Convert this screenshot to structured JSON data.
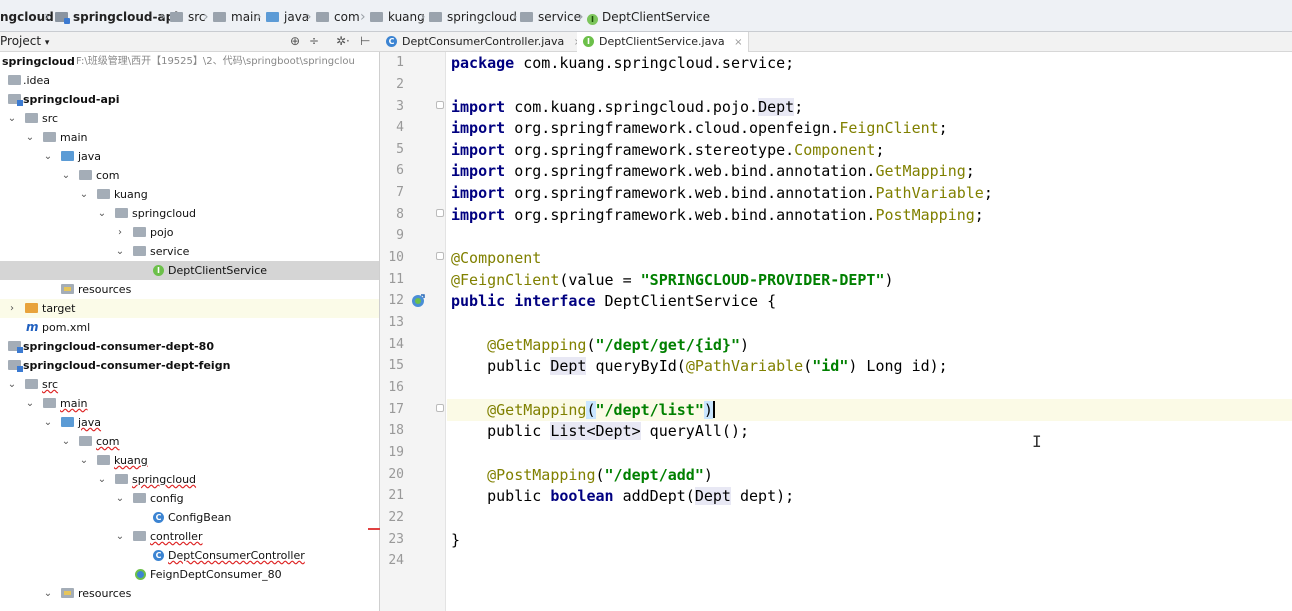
{
  "breadcrumb": [
    "ngcloud",
    "springcloud-api",
    "src",
    "main",
    "java",
    "com",
    "kuang",
    "springcloud",
    "service",
    "DeptClientService"
  ],
  "project_panel": {
    "title": "Project",
    "title_arrow": "▾",
    "icons": [
      "globe-icon",
      "split-icon",
      "gear-icon",
      "hide-icon"
    ],
    "tree": [
      {
        "label": "springcloud",
        "path": "F:\\班级管理\\西开【19525】\\2、代码\\springboot\\springclou",
        "depth": 0,
        "bold": true
      },
      {
        "label": ".idea",
        "depth": 1
      },
      {
        "label": "springcloud-api",
        "depth": 1,
        "bold": true
      },
      {
        "label": "src",
        "depth": 1
      },
      {
        "label": "main",
        "depth": 2
      },
      {
        "label": "java",
        "depth": 3
      },
      {
        "label": "com",
        "depth": 4
      },
      {
        "label": "kuang",
        "depth": 5
      },
      {
        "label": "springcloud",
        "depth": 6
      },
      {
        "label": "pojo",
        "depth": 7
      },
      {
        "label": "service",
        "depth": 7
      },
      {
        "label": "DeptClientService",
        "depth": 8
      },
      {
        "label": "resources",
        "depth": 3
      },
      {
        "label": "target",
        "depth": 1
      },
      {
        "label": "pom.xml",
        "depth": 1
      },
      {
        "label": "springcloud-consumer-dept-80",
        "depth": 0,
        "bold": true
      },
      {
        "label": "springcloud-consumer-dept-feign",
        "depth": 0,
        "bold": true
      },
      {
        "label": "src",
        "depth": 1
      },
      {
        "label": "main",
        "depth": 2
      },
      {
        "label": "java",
        "depth": 3
      },
      {
        "label": "com",
        "depth": 4
      },
      {
        "label": "kuang",
        "depth": 5
      },
      {
        "label": "springcloud",
        "depth": 6
      },
      {
        "label": "config",
        "depth": 7
      },
      {
        "label": "ConfigBean",
        "depth": 8
      },
      {
        "label": "controller",
        "depth": 7
      },
      {
        "label": "DeptConsumerController",
        "depth": 8
      },
      {
        "label": "FeignDeptConsumer_80",
        "depth": 7
      },
      {
        "label": "resources",
        "depth": 3
      }
    ]
  },
  "editor": {
    "tabs": [
      {
        "label": "DeptConsumerController.java",
        "active": false,
        "close": "×"
      },
      {
        "label": "DeptClientService.java",
        "active": true,
        "close": "×"
      }
    ],
    "line_numbers": [
      "1",
      "2",
      "3",
      "4",
      "5",
      "6",
      "7",
      "8",
      "9",
      "10",
      "11",
      "12",
      "13",
      "14",
      "15",
      "16",
      "17",
      "18",
      "19",
      "20",
      "21",
      "22",
      "23",
      "24"
    ],
    "code": {
      "l1_kw": "package",
      "l1_rest": " com.kuang.springcloud.service;",
      "imp": "import",
      "l3_pkg": " com.kuang.springcloud.pojo.",
      "l3_cls": "Dept",
      "l4_pkg": " org.springframework.cloud.openfeign.",
      "l4_cls": "FeignClient",
      "l5_pkg": " org.springframework.stereotype.",
      "l5_cls": "Component",
      "l6_pkg": " org.springframework.web.bind.annotation.",
      "l6_cls": "GetMapping",
      "l7_pkg": " org.springframework.web.bind.annotation.",
      "l7_cls": "PathVariable",
      "l8_pkg": " org.springframework.web.bind.annotation.",
      "l8_cls": "PostMapping",
      "semi": ";",
      "l10": "@Component",
      "l11_ann": "@FeignClient",
      "l11_open": "(value = ",
      "l11_str": "\"SPRINGCLOUD-PROVIDER-DEPT\"",
      "l11_close": ")",
      "l12_kw1": "public",
      "l12_kw2": "interface",
      "l12_rest": " DeptClientService {",
      "l14_ann": "@GetMapping",
      "l14_open": "(",
      "l14_str": "\"/dept/get/{id}\"",
      "l14_close": ")",
      "l15_pub": "public ",
      "l15_type": "Dept",
      "l15_mid": " queryById(",
      "l15_ann": "@PathVariable",
      "l15_open": "(",
      "l15_str": "\"id\"",
      "l15_rest": ") Long id);",
      "l17_ann": "@GetMapping",
      "l17_open": "(",
      "l17_str": "\"/dept/list\"",
      "l17_close": ")",
      "l18_pub": "public ",
      "l18_type": "List<Dept>",
      "l18_rest": " queryAll();",
      "l20_ann": "@PostMapping",
      "l20_open": "(",
      "l20_str": "\"/dept/add\"",
      "l20_close": ")",
      "l21_pub": "public ",
      "l21_kw": "boolean",
      "l21_mid": " addDept(",
      "l21_type": "Dept",
      "l21_rest": " dept);",
      "l23": "}"
    },
    "cursor_line": "17"
  },
  "colors": {
    "keyword": "#000080",
    "annotation": "#808000",
    "string": "#008000",
    "current_line": "#fbfae6",
    "selected_row": "#d5d5d5"
  }
}
